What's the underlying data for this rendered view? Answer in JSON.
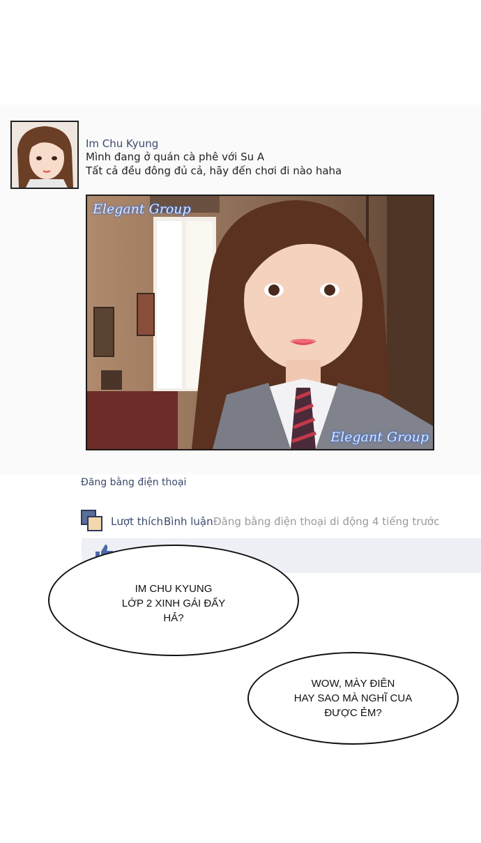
{
  "post": {
    "author": "Im Chu Kyung",
    "status_line1": "Mình đang ở quán cà phê với Su A",
    "status_line2": "Tất cả đều đông đủ cả, hãy đến chơi đi nào haha",
    "photo_watermark": "Elegant Group",
    "posted_via": "Đăng bằng điện thoại"
  },
  "actions": {
    "like": "Lượt thích",
    "comment": "Bình luận",
    "meta": "Đăng bằng điện thoại di động 4 tiếng trước"
  },
  "bubbles": {
    "first": [
      "IM CHU KYUNG",
      "LỚP 2 XINH GÁI ĐẤY",
      "HẢ?"
    ],
    "second": [
      "WOW, MÀY ĐIÊN",
      "HAY SAO MÀ NGHĨ CUA",
      "ĐƯỢC ẺM?"
    ]
  },
  "icons": {
    "action": "stacked-squares-icon",
    "comment_thumb": "thumbs-up-icon"
  }
}
